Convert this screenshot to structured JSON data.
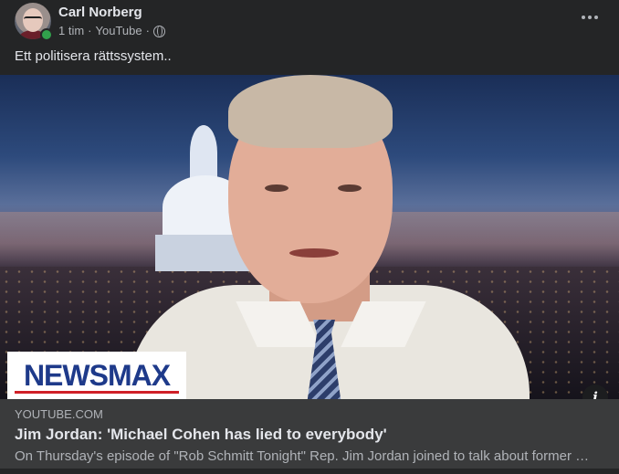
{
  "post": {
    "author": "Carl Norberg",
    "time": "1 tim",
    "source": "YouTube",
    "separator": "·",
    "text": "Ett politisera rättssystem.."
  },
  "media": {
    "logo_text": "NEWSMAX",
    "info_label": "i"
  },
  "link": {
    "domain": "YOUTUBE.COM",
    "title": "Jim Jordan: 'Michael Cohen has lied to everybody'",
    "description": "On Thursday's episode of \"Rob Schmitt Tonight\" Rep. Jim Jordan joined to talk about former President Donald Trump's trial and Michael Cohen."
  },
  "colors": {
    "online": "#31a24c",
    "logo_blue": "#1e3a8a",
    "logo_red": "#cf2027"
  }
}
